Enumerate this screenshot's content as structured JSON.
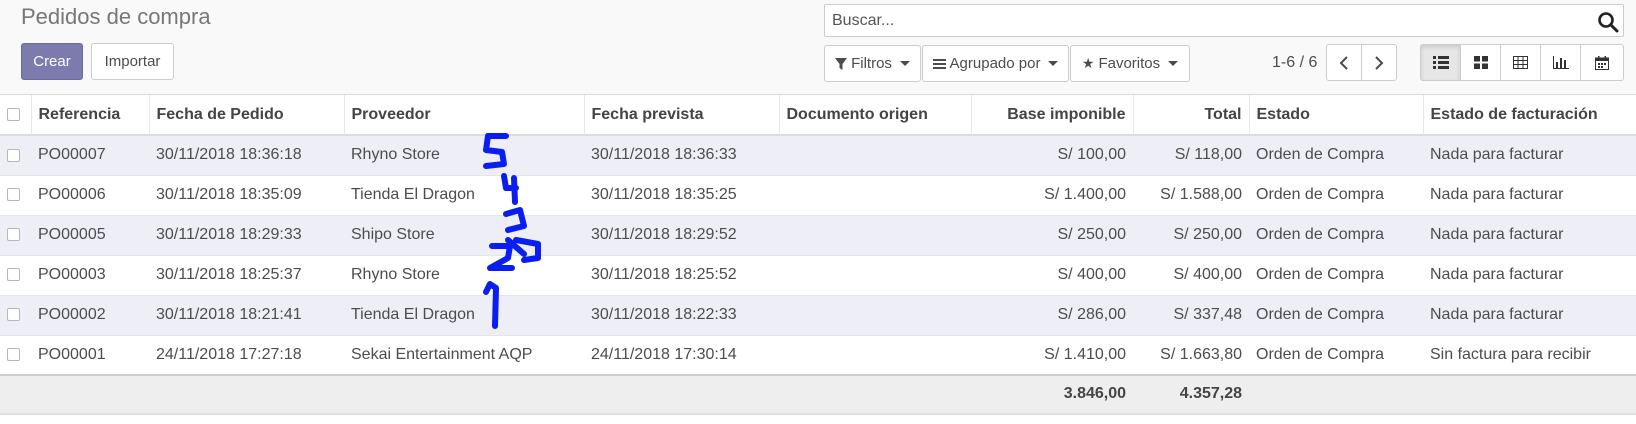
{
  "header": {
    "title": "Pedidos de compra"
  },
  "search": {
    "placeholder": "Buscar..."
  },
  "buttons": {
    "create": "Crear",
    "import": "Importar"
  },
  "filters": {
    "filters": "Filtros",
    "group_by": "Agrupado por",
    "favorites": "Favoritos"
  },
  "pager": {
    "value": "1-6 / 6"
  },
  "views": [
    "list",
    "kanban",
    "pivot",
    "graph",
    "calendar"
  ],
  "table": {
    "headers": [
      "Referencia",
      "Fecha de Pedido",
      "Proveedor",
      "Fecha prevista",
      "Documento origen",
      "Base imponible",
      "Total",
      "Estado",
      "Estado de facturación"
    ],
    "rows": [
      [
        "PO00007",
        "30/11/2018 18:36:18",
        "Rhyno Store",
        "30/11/2018 18:36:33",
        "",
        "S/ 100,00",
        "S/ 118,00",
        "Orden de Compra",
        "Nada para facturar"
      ],
      [
        "PO00006",
        "30/11/2018 18:35:09",
        "Tienda El Dragon",
        "30/11/2018 18:35:25",
        "",
        "S/ 1.400,00",
        "S/ 1.588,00",
        "Orden de Compra",
        "Nada para facturar"
      ],
      [
        "PO00005",
        "30/11/2018 18:29:33",
        "Shipo Store",
        "30/11/2018 18:29:52",
        "",
        "S/ 250,00",
        "S/ 250,00",
        "Orden de Compra",
        "Nada para facturar"
      ],
      [
        "PO00003",
        "30/11/2018 18:25:37",
        "Rhyno Store",
        "30/11/2018 18:25:52",
        "",
        "S/ 400,00",
        "S/ 400,00",
        "Orden de Compra",
        "Nada para facturar"
      ],
      [
        "PO00002",
        "30/11/2018 18:21:41",
        "Tienda El Dragon",
        "30/11/2018 18:22:33",
        "",
        "S/ 286,00",
        "S/ 337,48",
        "Orden de Compra",
        "Nada para facturar"
      ],
      [
        "PO00001",
        "24/11/2018 17:27:18",
        "Sekai Entertainment AQP",
        "24/11/2018 17:30:14",
        "",
        "S/ 1.410,00",
        "S/ 1.663,80",
        "Orden de Compra",
        "Sin factura para recibir"
      ]
    ],
    "totals": {
      "base": "3.846,00",
      "total": "4.357,28"
    }
  },
  "colors": {
    "primary": "#7c7bad",
    "row_alt": "#eeeef7",
    "annotation": "#0a1ef0"
  }
}
